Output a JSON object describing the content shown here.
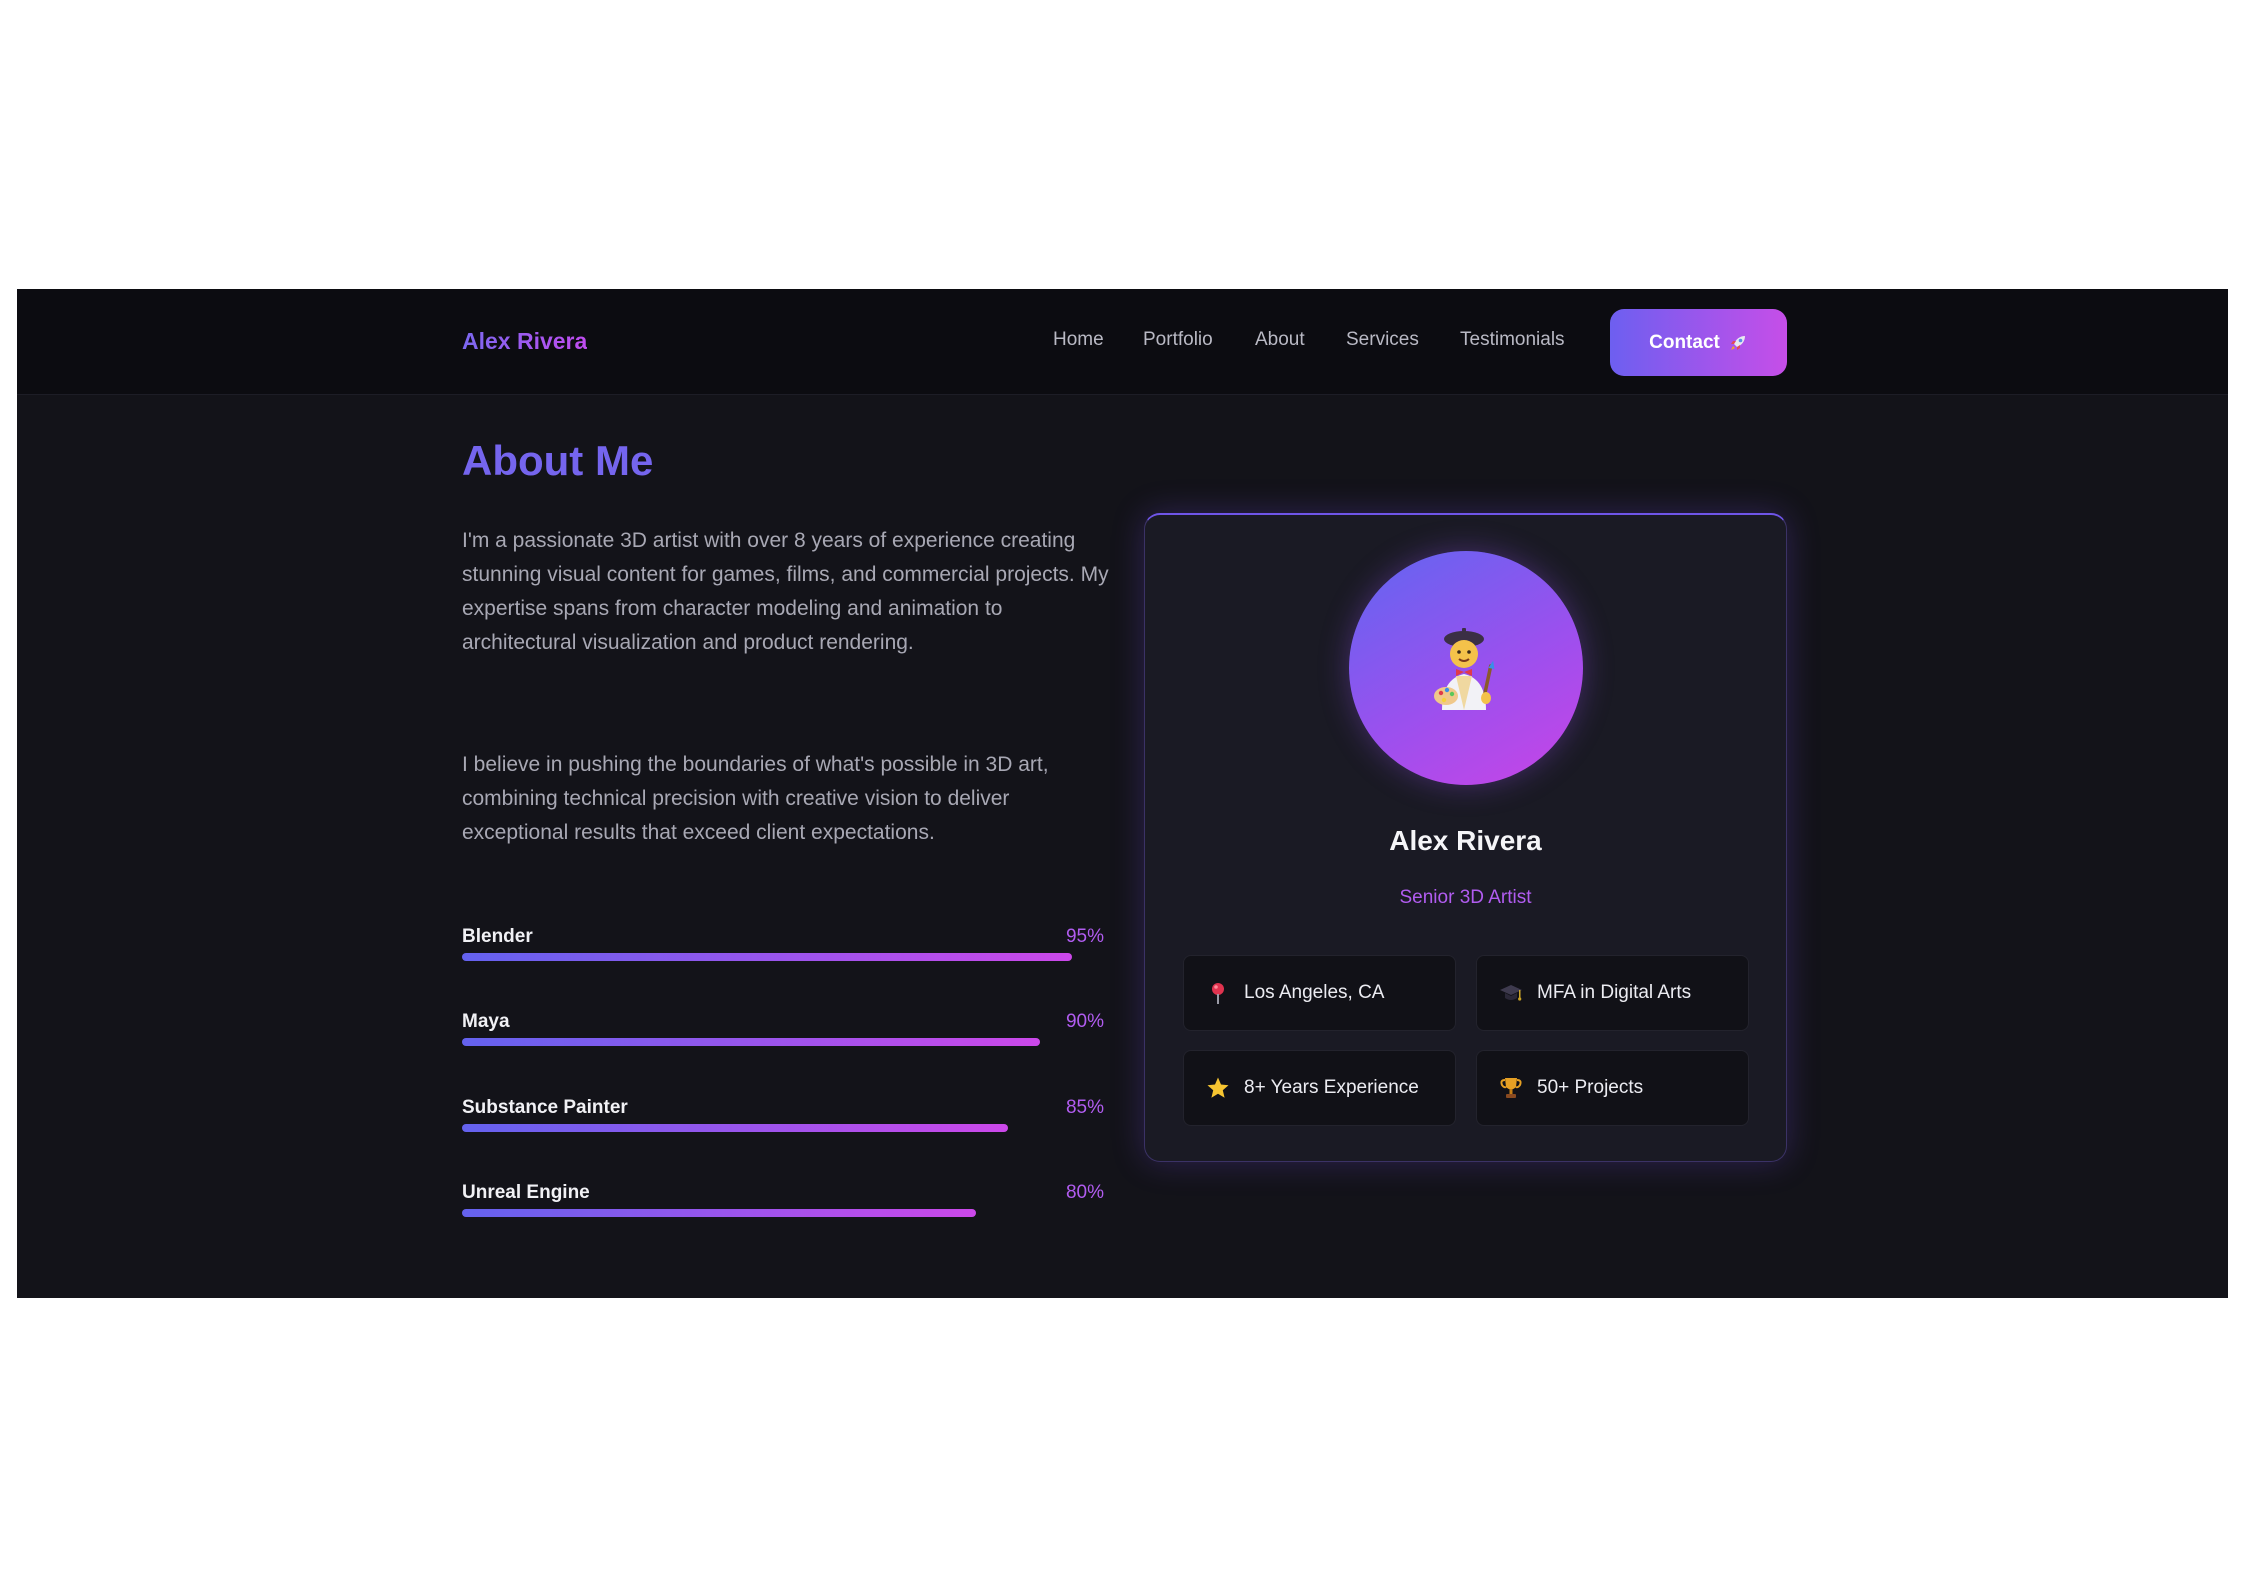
{
  "nav": {
    "brand": "Alex Rivera",
    "links": [
      "Home",
      "Portfolio",
      "About",
      "Services",
      "Testimonials"
    ],
    "contact_label": "Contact",
    "contact_icon": "rocket-icon"
  },
  "about": {
    "title": "About Me",
    "paragraphs": [
      "I'm a passionate 3D artist with over 8 years of experience creating stunning visual content for games, films, and commercial projects. My expertise spans from character modeling and animation to architectural visualization and product rendering.",
      "I believe in pushing the boundaries of what's possible in 3D art, combining technical precision with creative vision to deliver exceptional results that exceed client expectations."
    ],
    "skills": [
      {
        "name": "Blender",
        "percent_label": "95%",
        "level": 0.95
      },
      {
        "name": "Maya",
        "percent_label": "90%",
        "level": 0.9
      },
      {
        "name": "Substance Painter",
        "percent_label": "85%",
        "level": 0.85
      },
      {
        "name": "Unreal Engine",
        "percent_label": "80%",
        "level": 0.8
      }
    ]
  },
  "profile": {
    "avatar_icon": "artist-icon",
    "name": "Alex Rivera",
    "role": "Senior 3D Artist",
    "info": [
      {
        "icon": "pin-icon",
        "text": "Los Angeles, CA"
      },
      {
        "icon": "graduation-cap-icon",
        "text": "MFA in Digital Arts"
      },
      {
        "icon": "star-icon",
        "text": "8+ Years Experience"
      },
      {
        "icon": "trophy-icon",
        "text": "50+ Projects"
      }
    ]
  },
  "colors": {
    "background": "#131319",
    "nav_background": "#0c0c11",
    "accent_start": "#6d5ff0",
    "accent_end": "#c64ee8",
    "heading": "#7565ee",
    "percent": "#b15cf0"
  }
}
